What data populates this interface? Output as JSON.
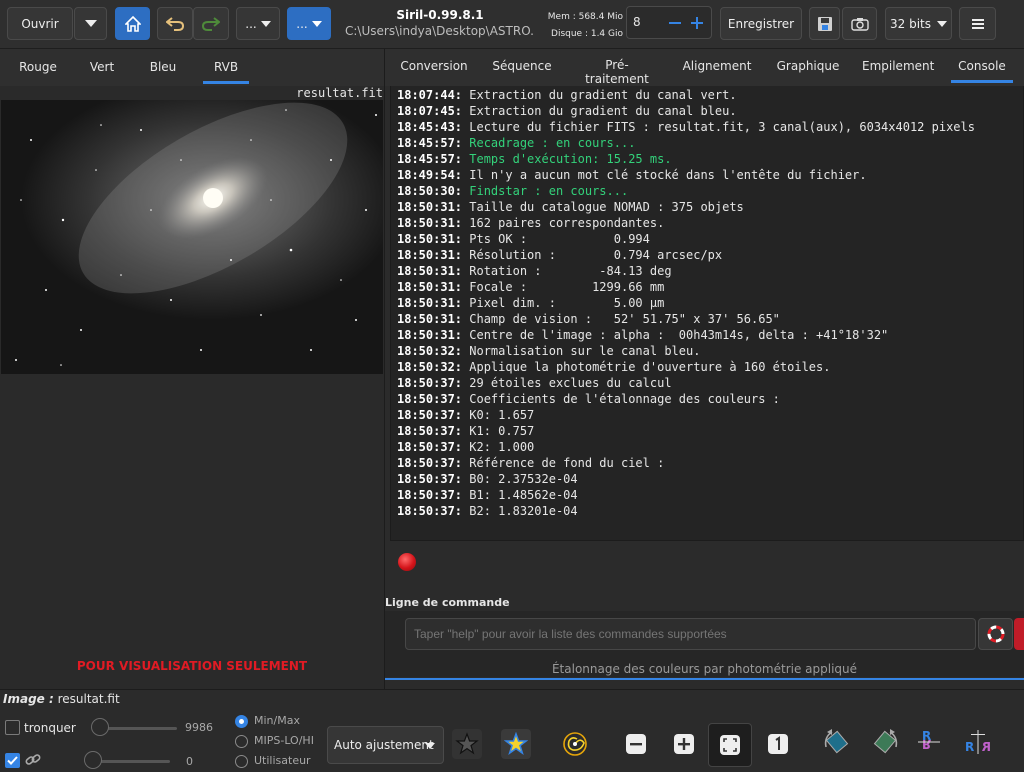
{
  "header": {
    "open_label": "Ouvrir",
    "dots_label_1": "...",
    "dots_label_2": "...",
    "app_title": "Siril-0.99.8.1",
    "path": "C:\\Users\\indya\\Desktop\\ASTRO...",
    "mem_label": "Mem : 568.4 Mio",
    "disk_label": "Disque : 1.4 Gio",
    "threads_value": "8",
    "save_label": "Enregistrer",
    "bits_label": "32 bits"
  },
  "channel_tabs": [
    "Rouge",
    "Vert",
    "Bleu",
    "RVB"
  ],
  "active_channel": 3,
  "image_name": "resultat.fit",
  "preview_notice": "POUR VISUALISATION SEULEMENT",
  "main_tabs": [
    "Conversion",
    "Séquence",
    "Pré-traitement",
    "Alignement",
    "Graphique",
    "Empilement",
    "Console"
  ],
  "active_main_tab": 6,
  "console_lines": [
    {
      "t": "18:07:44:",
      "m": "Extraction du gradient du canal vert.",
      "c": "normal"
    },
    {
      "t": "18:07:45:",
      "m": "Extraction du gradient du canal bleu.",
      "c": "normal"
    },
    {
      "t": "18:45:43:",
      "m": "Lecture du fichier FITS : resultat.fit, 3 canal(aux), 6034x4012 pixels",
      "c": "normal"
    },
    {
      "t": "18:45:57:",
      "m": "Recadrage : en cours...",
      "c": "green"
    },
    {
      "t": "18:45:57:",
      "m": "Temps d'exécution: 15.25 ms.",
      "c": "green"
    },
    {
      "t": "18:49:54:",
      "m": "Il n'y a aucun mot clé stocké dans l'entête du fichier.",
      "c": "normal"
    },
    {
      "t": "18:50:30:",
      "m": "Findstar : en cours...",
      "c": "green"
    },
    {
      "t": "18:50:31:",
      "m": "Taille du catalogue NOMAD : 375 objets",
      "c": "normal"
    },
    {
      "t": "18:50:31:",
      "m": "162 paires correspondantes.",
      "c": "normal"
    },
    {
      "t": "18:50:31:",
      "m": "Pts OK :            0.994",
      "c": "normal"
    },
    {
      "t": "18:50:31:",
      "m": "Résolution :        0.794 arcsec/px",
      "c": "normal"
    },
    {
      "t": "18:50:31:",
      "m": "Rotation :        -84.13 deg",
      "c": "normal"
    },
    {
      "t": "18:50:31:",
      "m": "Focale :         1299.66 mm",
      "c": "normal"
    },
    {
      "t": "18:50:31:",
      "m": "Pixel dim. :        5.00 µm",
      "c": "normal"
    },
    {
      "t": "18:50:31:",
      "m": "Champ de vision :   52' 51.75\" x 37' 56.65\"",
      "c": "normal"
    },
    {
      "t": "18:50:31:",
      "m": "Centre de l'image : alpha :  00h43m14s, delta : +41°18'32\"",
      "c": "normal"
    },
    {
      "t": "18:50:32:",
      "m": "Normalisation sur le canal bleu.",
      "c": "normal"
    },
    {
      "t": "18:50:32:",
      "m": "Applique la photométrie d'ouverture à 160 étoiles.",
      "c": "normal"
    },
    {
      "t": "18:50:37:",
      "m": "29 étoiles exclues du calcul",
      "c": "normal"
    },
    {
      "t": "18:50:37:",
      "m": "Coefficients de l'étalonnage des couleurs :",
      "c": "normal"
    },
    {
      "t": "18:50:37:",
      "m": "K0: 1.657",
      "c": "normal"
    },
    {
      "t": "18:50:37:",
      "m": "K1: 0.757",
      "c": "normal"
    },
    {
      "t": "18:50:37:",
      "m": "K2: 1.000",
      "c": "normal"
    },
    {
      "t": "18:50:37:",
      "m": "Référence de fond du ciel :",
      "c": "normal"
    },
    {
      "t": "18:50:37:",
      "m": "B0: 2.37532e-04",
      "c": "normal"
    },
    {
      "t": "18:50:37:",
      "m": "B1: 1.48562e-04",
      "c": "normal"
    },
    {
      "t": "18:50:37:",
      "m": "B2: 1.83201e-04",
      "c": "normal"
    }
  ],
  "command": {
    "label": "Ligne de commande",
    "placeholder": "Taper \"help\" pour avoir la liste des commandes supportées"
  },
  "status_text": "Étalonnage des couleurs par photométrie appliqué",
  "bottom": {
    "image_label": "Image :",
    "image_name": "resultat.fit",
    "clip_label": "tronquer",
    "high_value": "9986",
    "low_value": "0",
    "radio_options": [
      "Min/Max",
      "MIPS-LO/HI",
      "Utilisateur"
    ],
    "selected_radio": 0,
    "auto_label": "Auto ajustement"
  },
  "colors": {
    "accent": "#3584e4",
    "green_text": "#33d17a",
    "red_notice": "#e01b24",
    "background": "#2b2b2b"
  }
}
